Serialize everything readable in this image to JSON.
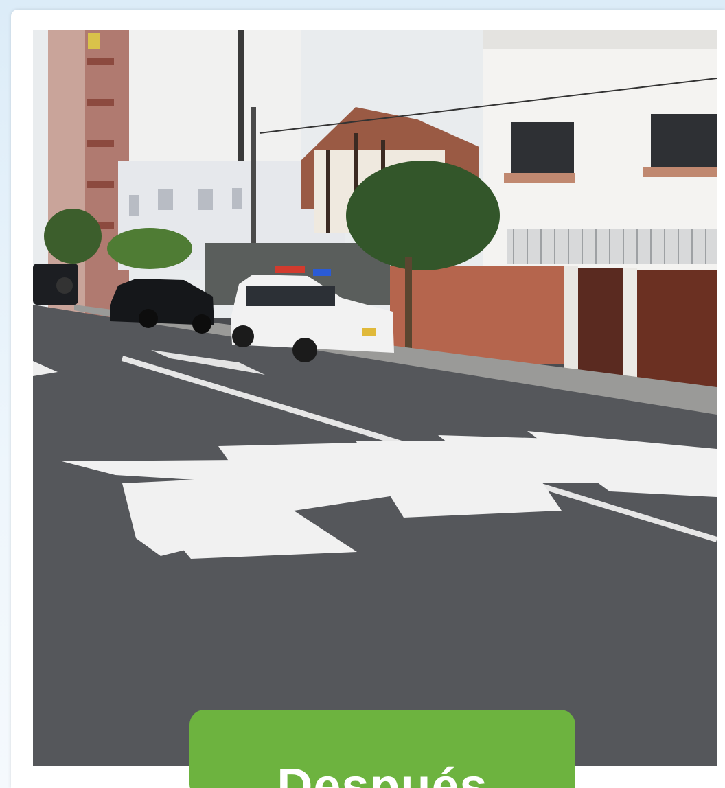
{
  "badge": {
    "label": "Después",
    "color": "#6db33f"
  },
  "photo": {
    "subject": "street",
    "road_marking": "PARE"
  }
}
